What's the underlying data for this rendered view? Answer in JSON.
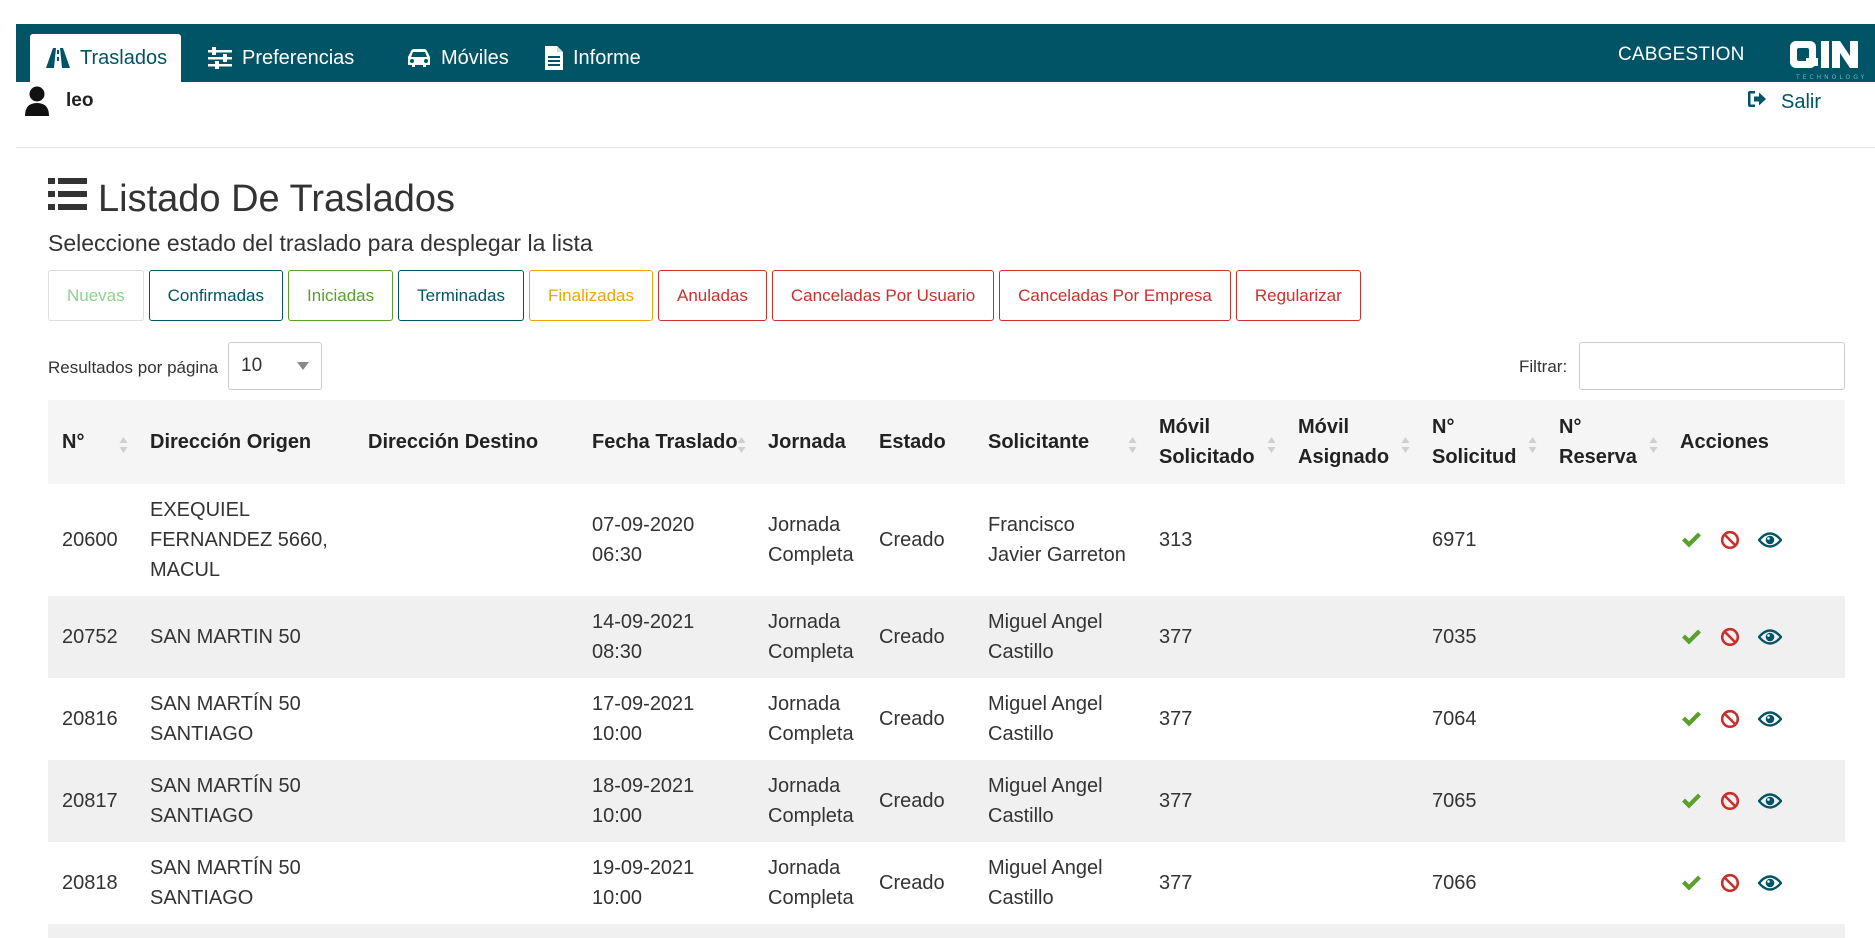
{
  "navbar": {
    "tabs": [
      {
        "label": "Traslados",
        "icon": "road-icon",
        "active": true
      },
      {
        "label": "Preferencias",
        "icon": "sliders-icon",
        "active": false
      },
      {
        "label": "Móviles",
        "icon": "car-icon",
        "active": false
      },
      {
        "label": "Informe",
        "icon": "document-icon",
        "active": false
      }
    ],
    "brand": "CABGESTION",
    "logo_text": "QIN",
    "logo_subtext": "TECHNOLOGY",
    "bg_color": "#005465"
  },
  "user": {
    "name": "leo",
    "logout_label": "Salir"
  },
  "page": {
    "title": "Listado De Traslados",
    "subtitle": "Seleccione estado del traslado para desplegar la lista"
  },
  "status_buttons": [
    {
      "label": "Nuevas",
      "color": "#8fd08f",
      "border": "#dddddd",
      "faded": true
    },
    {
      "label": "Confirmadas",
      "color": "#005465",
      "border": "#005465"
    },
    {
      "label": "Iniciadas",
      "color": "#5aa02c",
      "border": "#5aa02c"
    },
    {
      "label": "Terminadas",
      "color": "#005465",
      "border": "#005465"
    },
    {
      "label": "Finalizadas",
      "color": "#f0a30a",
      "border": "#f0a30a"
    },
    {
      "label": "Anuladas",
      "color": "#c9302c",
      "border": "#c9302c"
    },
    {
      "label": "Canceladas Por Usuario",
      "color": "#c9302c",
      "border": "#c9302c"
    },
    {
      "label": "Canceladas Por Empresa",
      "color": "#c9302c",
      "border": "#c9302c"
    },
    {
      "label": "Regularizar",
      "color": "#c9302c",
      "border": "#c9302c"
    }
  ],
  "table_controls": {
    "length_label": "Resultados por página",
    "length_value": "10",
    "filter_label": "Filtrar:",
    "filter_value": ""
  },
  "table": {
    "columns": [
      {
        "label": "N°",
        "sortable": true
      },
      {
        "label": "Dirección Origen",
        "sortable": false
      },
      {
        "label": "Dirección Destino",
        "sortable": false
      },
      {
        "label": "Fecha Traslado",
        "sortable": true
      },
      {
        "label": "Jornada",
        "sortable": false
      },
      {
        "label": "Estado",
        "sortable": false
      },
      {
        "label": "Solicitante",
        "sortable": true
      },
      {
        "label": "Móvil Solicitado",
        "sortable": true
      },
      {
        "label": "Móvil Asignado",
        "sortable": true
      },
      {
        "label": "N° Solicitud",
        "sortable": true
      },
      {
        "label": "N° Reserva",
        "sortable": true
      },
      {
        "label": "Acciones",
        "sortable": false
      }
    ],
    "rows": [
      {
        "n": "20600",
        "origen": "EXEQUIEL FERNANDEZ 5660, MACUL",
        "destino": "",
        "fecha": "07-09-2020 06:30",
        "jornada": "Jornada Completa",
        "estado": "Creado",
        "solicitante": "Francisco Javier Garreton",
        "movil_solicitado": "313",
        "movil_asignado": "",
        "solicitud": "6971",
        "reserva": ""
      },
      {
        "n": "20752",
        "origen": "SAN MARTIN 50",
        "destino": "",
        "fecha": "14-09-2021 08:30",
        "jornada": "Jornada Completa",
        "estado": "Creado",
        "solicitante": "Miguel Angel Castillo",
        "movil_solicitado": "377",
        "movil_asignado": "",
        "solicitud": "7035",
        "reserva": ""
      },
      {
        "n": "20816",
        "origen": "SAN MARTÍN 50 SANTIAGO",
        "destino": "",
        "fecha": "17-09-2021 10:00",
        "jornada": "Jornada Completa",
        "estado": "Creado",
        "solicitante": "Miguel Angel Castillo",
        "movil_solicitado": "377",
        "movil_asignado": "",
        "solicitud": "7064",
        "reserva": ""
      },
      {
        "n": "20817",
        "origen": "SAN MARTÍN 50 SANTIAGO",
        "destino": "",
        "fecha": "18-09-2021 10:00",
        "jornada": "Jornada Completa",
        "estado": "Creado",
        "solicitante": "Miguel Angel Castillo",
        "movil_solicitado": "377",
        "movil_asignado": "",
        "solicitud": "7065",
        "reserva": ""
      },
      {
        "n": "20818",
        "origen": "SAN MARTÍN 50 SANTIAGO",
        "destino": "",
        "fecha": "19-09-2021 10:00",
        "jornada": "Jornada Completa",
        "estado": "Creado",
        "solicitante": "Miguel Angel Castillo",
        "movil_solicitado": "377",
        "movil_asignado": "",
        "solicitud": "7066",
        "reserva": ""
      }
    ],
    "action_icons": [
      "check-icon",
      "ban-icon",
      "eye-icon"
    ],
    "action_colors": {
      "confirm": "#5aa02c",
      "cancel": "#c9302c",
      "view": "#005465"
    }
  }
}
